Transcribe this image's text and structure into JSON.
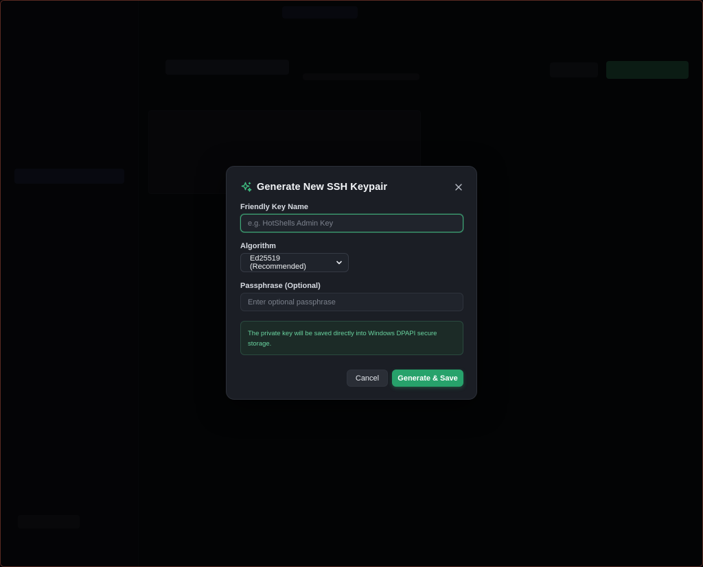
{
  "modal": {
    "title": "Generate New SSH Keypair",
    "title_icon": "sparkle-icon",
    "close_icon": "close-icon",
    "key_name": {
      "label": "Friendly Key Name",
      "value": "",
      "placeholder": "e.g. HotShells Admin Key"
    },
    "algorithm": {
      "label": "Algorithm",
      "selected": "Ed25519 (Recommended)"
    },
    "passphrase": {
      "label": "Passphrase (Optional)",
      "value": "",
      "placeholder": "Enter optional passphrase"
    },
    "info": "The private key will be saved directly into Windows DPAPI secure storage.",
    "cancel_label": "Cancel",
    "generate_label": "Generate & Save"
  },
  "colors": {
    "accent": "#27a26b",
    "info_text": "#69d39f",
    "modal_bg": "#1b1e25",
    "backdrop": "#050507"
  }
}
